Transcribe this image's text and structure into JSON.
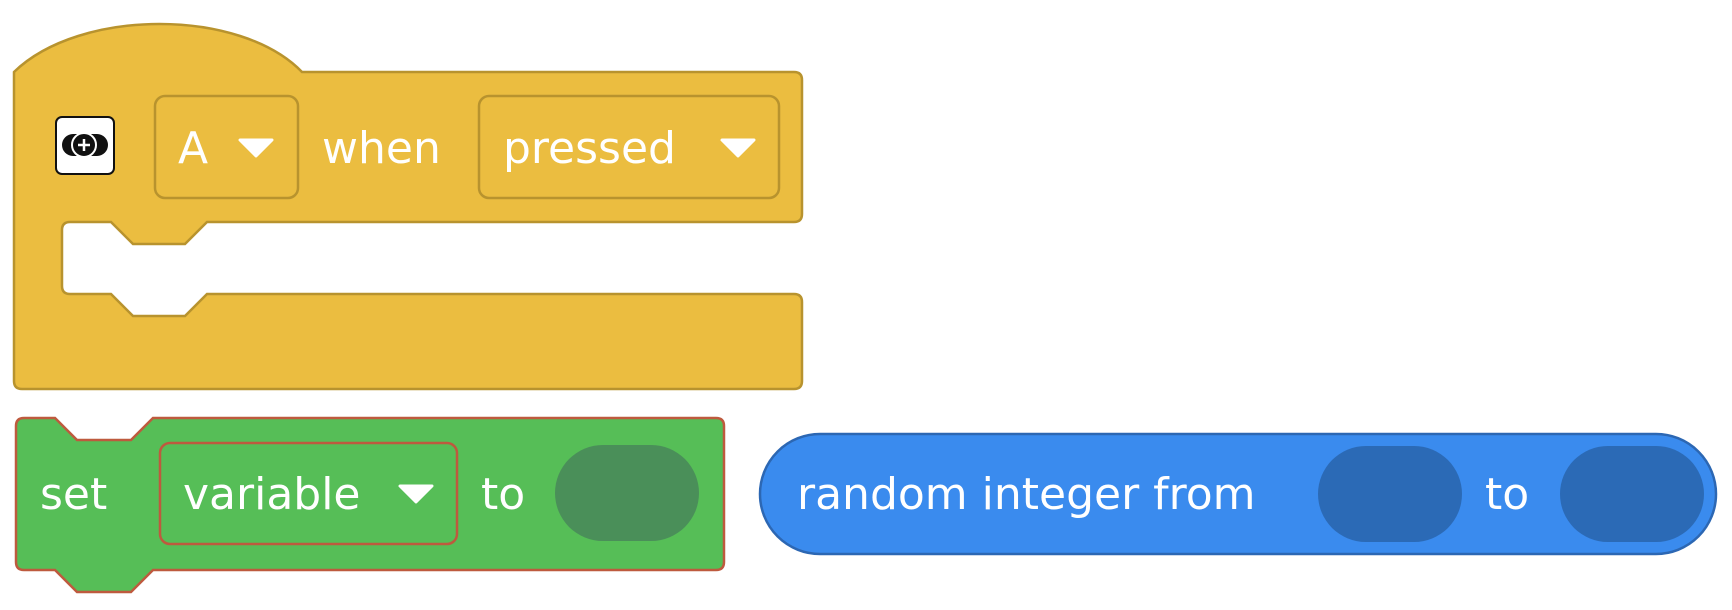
{
  "colors": {
    "event_fill": "#EBBD40",
    "event_stroke": "#B8932E",
    "variable_fill": "#56BE57",
    "variable_stroke": "#BE5A3E",
    "variable_slot": "#4A8F59",
    "math_fill": "#3A8BEE",
    "math_stroke": "#2C67B3",
    "math_slot": "#2B6AB6",
    "text": "#FFFFFF"
  },
  "event_block": {
    "icon": "gamepad-button-icon",
    "button_value": "A",
    "when_label": "when",
    "state_value": "pressed"
  },
  "set_block": {
    "set_label": "set",
    "variable_value": "variable",
    "to_label": "to"
  },
  "random_block": {
    "label": "random integer from",
    "to_label": "to"
  }
}
